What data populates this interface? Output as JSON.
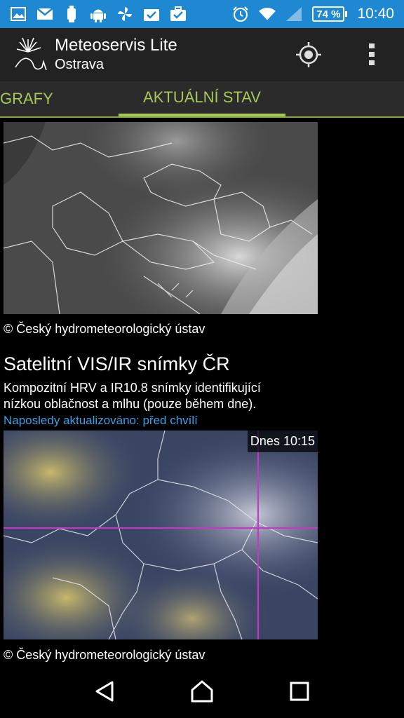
{
  "status_bar": {
    "left_icons": [
      "gallery-icon",
      "gmail-icon",
      "usb-debug-icon",
      "android-icon",
      "pinwheel-icon",
      "task-check-icon",
      "briefcase-check-icon"
    ],
    "right_icons": [
      "alarm-icon",
      "wifi-icon",
      "cellular-signal-icon"
    ],
    "battery": "74 %",
    "time": "10:40"
  },
  "app_bar": {
    "title": "Meteoservis Lite",
    "subtitle": "Ostrava",
    "actions": [
      "location-icon",
      "overflow-menu-icon"
    ]
  },
  "tabs": [
    {
      "label": "GRAFY",
      "active": false
    },
    {
      "label": "AKTUÁLNÍ STAV",
      "active": true
    }
  ],
  "content": {
    "image1": {
      "description_icon": "satellite-ir-map-image",
      "copyright": "© Český hydrometeorologický ústav"
    },
    "section2": {
      "title": "Satelitní VIS/IR snímky ČR",
      "description": "Kompozitní HRV a IR10.8 snímky identifikující nízkou oblačnost a mlhu (pouze během dne).",
      "updated": "Naposledy aktualizováno: před chvílí",
      "timestamp": "Dnes 10:15",
      "copyright": "© Český hydrometeorologický ústav"
    }
  },
  "colors": {
    "status_bar": "#1e88d2",
    "app_bar": "#222222",
    "tab_accent": "#a6c85a",
    "link": "#3aa0e8",
    "crosshair": "#cc33cc"
  },
  "nav_bar": [
    "back-icon",
    "home-icon",
    "recents-icon"
  ]
}
